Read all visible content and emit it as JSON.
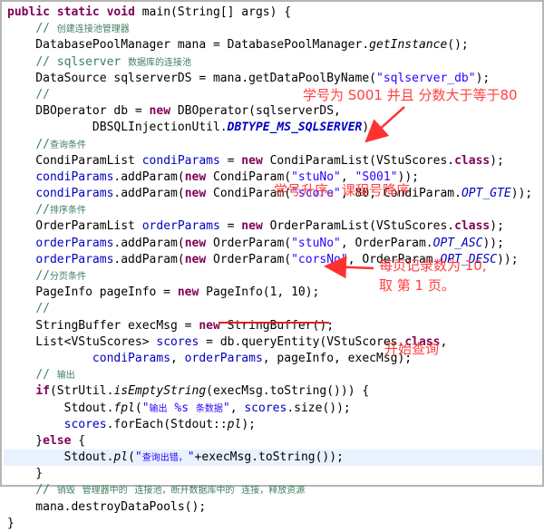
{
  "code_lines": [
    "public static void main(String[] args) {",
    "    // 创建连接池管理器",
    "    DatabasePoolManager mana = DatabasePoolManager.getInstance();",
    "    // sqlserver 数据库的连接池",
    "    DataSource sqlserverDS = mana.getDataPoolByName(\"sqlserver_db\");",
    "    //",
    "    DBOperator db = new DBOperator(sqlserverDS,",
    "            DBSQLInjectionUtil.DBTYPE_MS_SQLSERVER);",
    "    //查询条件",
    "    CondiParamList condiParams = new CondiParamList(VStuScores.class);",
    "    condiParams.addParam(new CondiParam(\"stuNo\", \"S001\"));",
    "    condiParams.addParam(new CondiParam(\"score\", 80, CondiParam.OPT_GTE));",
    "    //排序条件",
    "    OrderParamList orderParams = new OrderParamList(VStuScores.class);",
    "    orderParams.addParam(new OrderParam(\"stuNo\", OrderParam.OPT_ASC));",
    "    orderParams.addParam(new OrderParam(\"corsNo\", OrderParam.OPT_DESC));",
    "    //分页条件",
    "    PageInfo pageInfo = new PageInfo(1, 10);",
    "    //",
    "    StringBuffer execMsg = new StringBuffer();",
    "    List<VStuScores> scores = db.queryEntity(VStuScores.class,",
    "            condiParams, orderParams, pageInfo, execMsg);",
    "    // 输出",
    "    if(StrUtil.isEmptyString(execMsg.toString())) {",
    "        Stdout.fpl(\"输出 %s 条数据\", scores.size());",
    "        scores.forEach(Stdout::pl);",
    "    }else {",
    "        Stdout.pl(\"查询出错，\"+execMsg.toString());",
    "    }",
    "    // 销毁 管理器中的 连接池，断开数据库中的 连接，释放资源",
    "    mana.destroyDataPools();",
    "}"
  ],
  "annotations": {
    "filter": "学号为 S001 并且 分数大于等于80",
    "order": "学号升序，课程号降序",
    "paging_line1": "每页记录数为 10,",
    "paging_line2": "取 第 1 页。",
    "query": "开始查询"
  },
  "colors": {
    "keyword": "#7f0055",
    "comment": "#3f7f5f",
    "string": "#2a00ff",
    "field": "#0000c0",
    "annotation": "#ff4040"
  }
}
